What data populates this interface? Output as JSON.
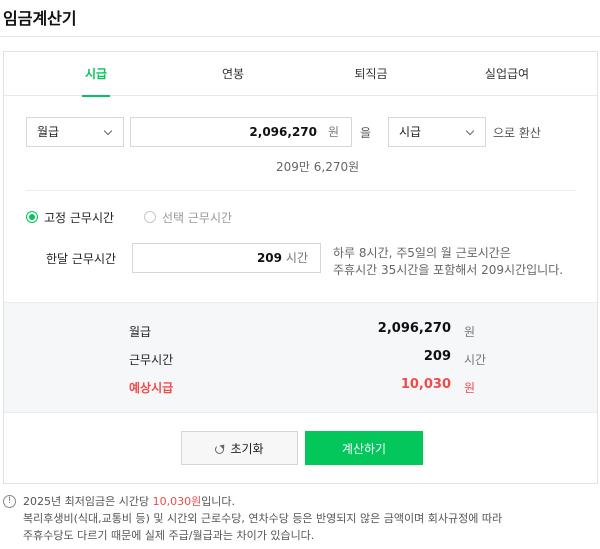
{
  "page_title": "임금계산기",
  "tabs": [
    {
      "label": "시급",
      "active": true
    },
    {
      "label": "연봉",
      "active": false
    },
    {
      "label": "퇴직금",
      "active": false
    },
    {
      "label": "실업급여",
      "active": false
    }
  ],
  "converter": {
    "from_type": "월급",
    "amount": "2,096,270",
    "amount_unit": "원",
    "particle": "을",
    "to_type": "시급",
    "suffix": "으로 환산",
    "amount_readable": "209만 6,270원"
  },
  "work_hours": {
    "fixed_label": "고정 근무시간",
    "select_label": "선택 근무시간",
    "fixed_selected": true,
    "monthly_label": "한달 근무시간",
    "monthly_value": "209",
    "monthly_unit": "시간",
    "help_line1": "하루 8시간, 주5일의 월 근로시간은",
    "help_line2": "주휴시간 35시간을 포함해서 209시간입니다."
  },
  "summary": {
    "rows": [
      {
        "label": "월급",
        "value": "2,096,270",
        "unit": "원"
      },
      {
        "label": "근무시간",
        "value": "209",
        "unit": "시간"
      },
      {
        "label": "예상시급",
        "value": "10,030",
        "unit": "원"
      }
    ]
  },
  "buttons": {
    "reset": "초기화",
    "calculate": "계산하기"
  },
  "notice": {
    "icon": "!",
    "line1_prefix": "2025년 최저임금은 시간당 ",
    "line1_highlight": "10,030원",
    "line1_suffix": "입니다.",
    "line2": "복리후생비(식대,교통비 등) 및 시간외 근로수당, 연차수당 등은 반영되지 않은 금액이며 회사규정에 따라",
    "line3": "주휴수당도 다르기 때문에 실제 주급/월급과는 차이가 있습니다."
  },
  "colors": {
    "accent": "#03c75a",
    "highlight": "#f04a4a"
  },
  "icons": {
    "dropdown": "chevron-down-icon",
    "reset": "refresh-icon",
    "notice": "info-icon"
  }
}
